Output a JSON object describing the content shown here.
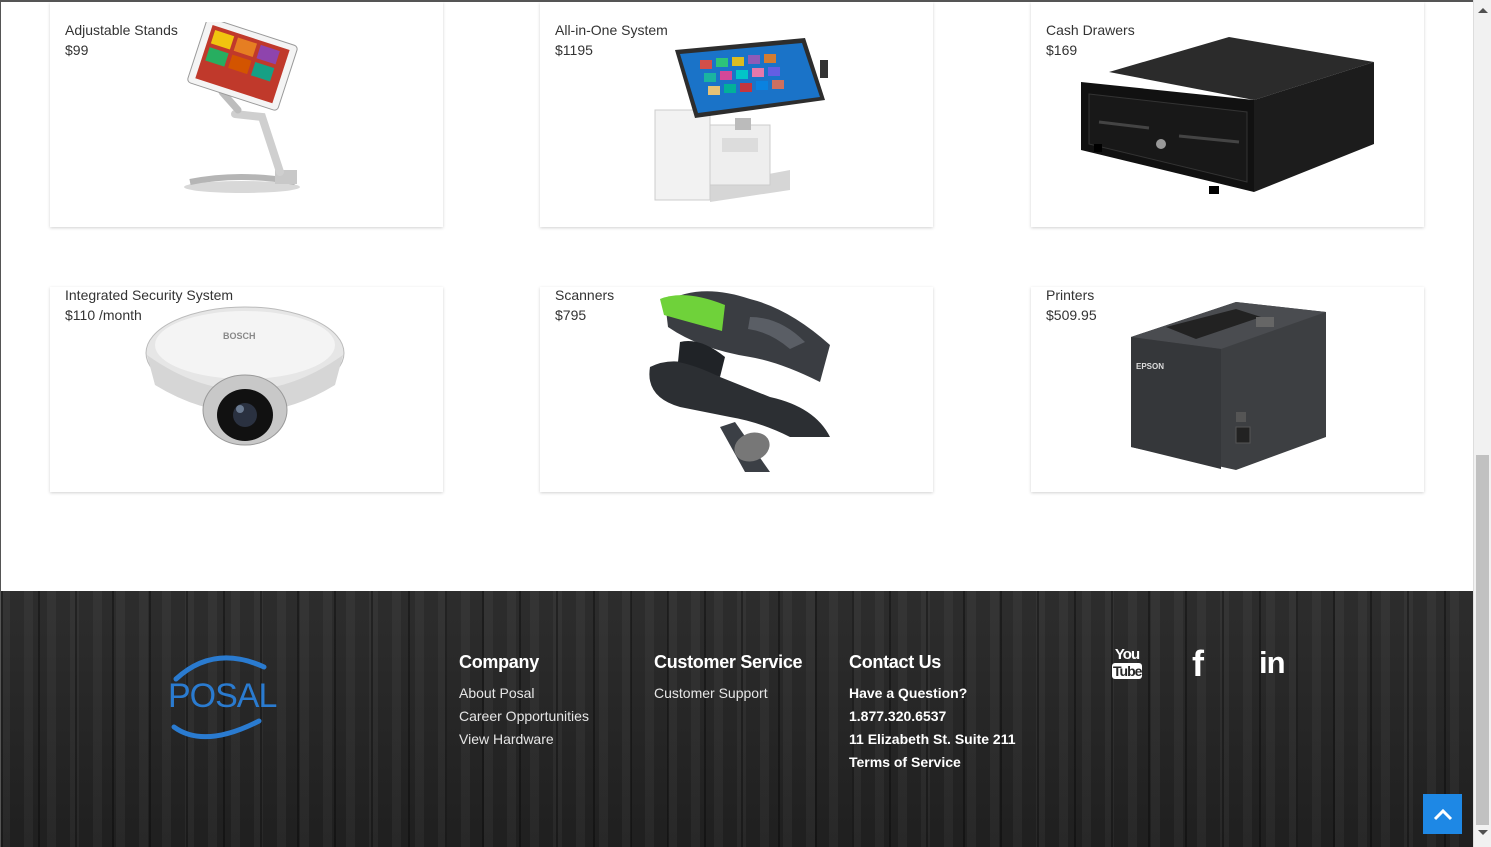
{
  "products": [
    {
      "title": "Adjustable Stands",
      "price": "$99",
      "icon": "tablet-stand-icon"
    },
    {
      "title": "All-in-One System",
      "price": "$1195",
      "icon": "pos-terminal-icon"
    },
    {
      "title": "Cash Drawers",
      "price": "$169",
      "icon": "cash-drawer-icon"
    },
    {
      "title": "Integrated Security System",
      "price": "$110 /month",
      "icon": "security-camera-icon"
    },
    {
      "title": "Scanners",
      "price": "$795",
      "icon": "barcode-scanner-icon"
    },
    {
      "title": "Printers",
      "price": "$509.95",
      "icon": "receipt-printer-icon"
    }
  ],
  "product_image_labels": {
    "camera_brand": "BOSCH",
    "printer_brand": "EPSON"
  },
  "footer": {
    "logo_text": "POSAL",
    "company": {
      "heading": "Company",
      "links": [
        "About Posal",
        "Career Opportunities",
        "View Hardware"
      ]
    },
    "customer_service": {
      "heading": "Customer Service",
      "links": [
        "Customer Support"
      ]
    },
    "contact": {
      "heading": "Contact Us",
      "lines": [
        "Have a Question?",
        "1.877.320.6537",
        "11 Elizabeth St. Suite 211",
        "Terms of Service"
      ]
    },
    "social": [
      {
        "name": "YouTube",
        "icon": "youtube-icon",
        "line1": "You",
        "line2": "Tube"
      },
      {
        "name": "Facebook",
        "icon": "facebook-icon",
        "glyph": "f"
      },
      {
        "name": "LinkedIn",
        "icon": "linkedin-icon",
        "glyph": "in"
      }
    ]
  },
  "colors": {
    "accent": "#1e88e5",
    "logo": "#2a7bd0",
    "footer_bg": "#262626"
  }
}
